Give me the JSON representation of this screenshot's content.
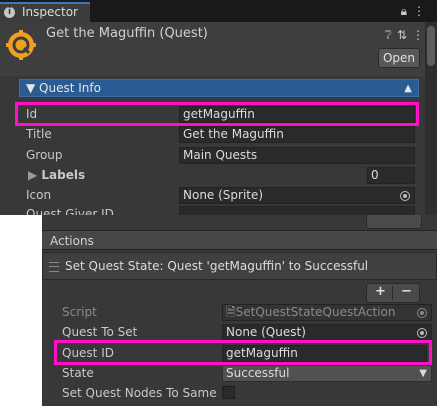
{
  "inspector": {
    "tab_label": "Inspector",
    "tab_icon": "info-icon",
    "header_title": "Get the Maguffin (Quest)",
    "open_label": "Open",
    "tabbar_icons": [
      "lock-icon",
      "menu-icon"
    ],
    "header_icons": [
      "help-icon",
      "preset-icon",
      "more-icon"
    ],
    "quest_info_label": "▼ Quest Info",
    "fields": {
      "id": {
        "label": "Id",
        "value": "getMaguffin"
      },
      "title": {
        "label": "Title",
        "value": "Get the Maguffin"
      },
      "group": {
        "label": "Group",
        "value": "Main Quests"
      },
      "labels": {
        "label": "Labels",
        "value": "0"
      },
      "icon": {
        "label": "Icon",
        "value": "None (Sprite)"
      },
      "quest_giver": {
        "label": "Quest Giver ID"
      }
    }
  },
  "actions_panel": {
    "header": "Actions",
    "action_item": "Set Quest State: Quest 'getMaguffin' to Successful",
    "plus": "+",
    "minus": "−",
    "fields": {
      "script": {
        "label": "Script",
        "value": "SetQuestStateQuestAction"
      },
      "quest_to_set": {
        "label": "Quest To Set",
        "value": "None (Quest)"
      },
      "quest_id": {
        "label": "Quest ID",
        "value": "getMaguffin"
      },
      "state": {
        "label": "State",
        "value": "Successful"
      },
      "set_nodes": {
        "label": "Set Quest Nodes To Same",
        "checked": false
      }
    }
  },
  "colors": {
    "highlight": "#ff10c8",
    "quest_info_bar": "#2a5b92"
  }
}
